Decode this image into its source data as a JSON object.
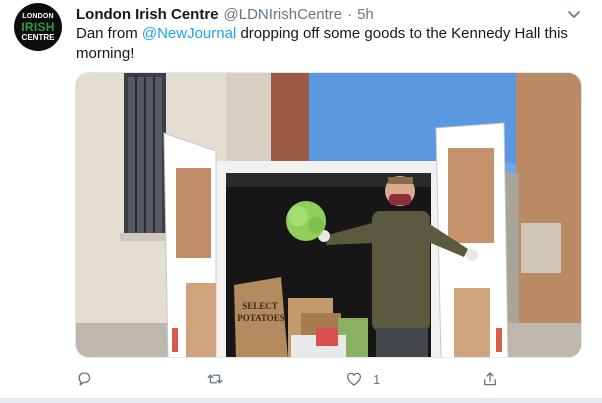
{
  "tweet": {
    "avatar": {
      "line1": "LONDON",
      "line2": "IRISH",
      "line3": "CENTRE"
    },
    "author_name": "London Irish Centre",
    "handle": "@LDNIrishCentre",
    "separator": "·",
    "time": "5h",
    "text_part1": "Dan from ",
    "mention": "@NewJournal",
    "text_part2": " dropping off some goods to the Kennedy Hall this morning!",
    "photo": {
      "sack_line1": "SELECT",
      "sack_line2": "POTATOES"
    },
    "actions": {
      "reply_icon": "reply-icon",
      "retweet_icon": "retweet-icon",
      "like_icon": "heart-icon",
      "like_count": "1",
      "share_icon": "share-icon"
    },
    "colors": {
      "accent": "#1da1f2",
      "muted": "#657786",
      "text": "#14171a"
    }
  }
}
